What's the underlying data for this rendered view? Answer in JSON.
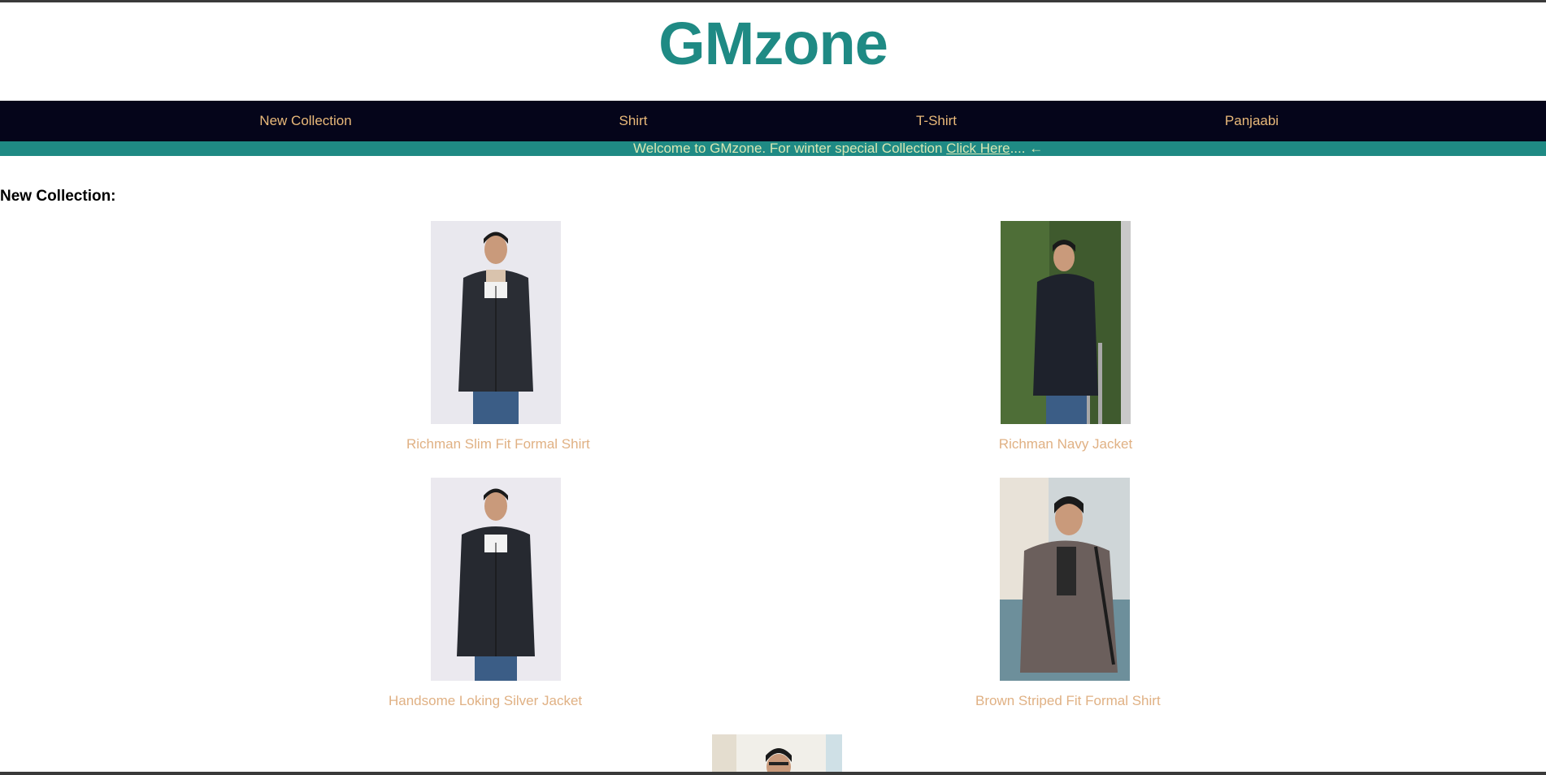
{
  "brand": {
    "title": "GMzone"
  },
  "nav": {
    "items": [
      {
        "label": "New Collection"
      },
      {
        "label": "Shirt"
      },
      {
        "label": "T-Shirt"
      },
      {
        "label": "Panjaabi"
      }
    ]
  },
  "ticker": {
    "text": "Welcome to GMzone. For winter special Collection ",
    "link_label": "Click Here",
    "suffix": ".... ",
    "arrow": "←"
  },
  "section": {
    "title": "New Collection:"
  },
  "products": [
    {
      "name": "Richman Slim Fit Formal Shirt"
    },
    {
      "name": "Richman Navy Jacket"
    },
    {
      "name": "Handsome Loking Silver Jacket"
    },
    {
      "name": "Brown Striped Fit Formal Shirt"
    }
  ],
  "colors": {
    "brand": "#1f8a84",
    "nav_bg": "#05051a",
    "nav_text": "#e9b97a",
    "ticker_bg": "#1f8a84",
    "caption": "#e0b184"
  }
}
